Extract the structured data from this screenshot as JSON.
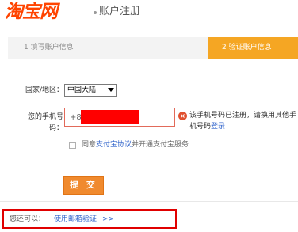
{
  "header": {
    "logo": "淘宝网",
    "title": "账户注册"
  },
  "steps": {
    "step1": "1 填写账户信息",
    "step2": "2 验证账户信息",
    "active_color": "#f5a623"
  },
  "form": {
    "region_label": "国家/地区：",
    "region_value": "中国大陆",
    "phone_label": "您的手机号码：",
    "phone_prefix": "+86",
    "error_icon": "error-x-icon",
    "error_text": "该手机号码已注册，请换用其他手机号码",
    "error_login": "登录",
    "agree_prefix": "同意",
    "agree_link": "支付宝协议",
    "agree_suffix": "并开通支付宝服务",
    "submit": "提 交"
  },
  "alternative": {
    "prefix": "您还可以：",
    "link": "使用邮箱验证",
    "arrow": ">>"
  },
  "colors": {
    "brand": "#ff4400",
    "submit": "#f08a2e",
    "link": "#3366cc",
    "highlight_box": "#e00000"
  }
}
